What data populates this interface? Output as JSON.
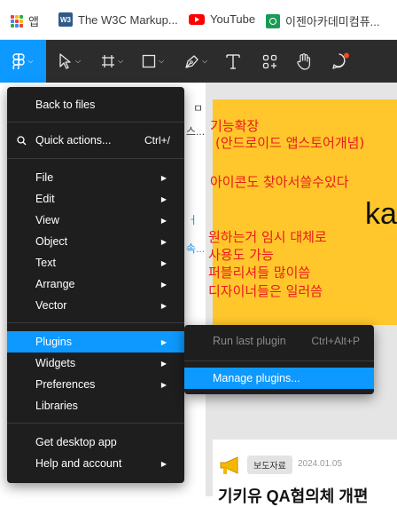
{
  "bookmarks": [
    {
      "label": "앱",
      "icon": "apps-grid-icon"
    },
    {
      "label": "The W3C Markup...",
      "icon": "w3c-icon"
    },
    {
      "label": "YouTube",
      "icon": "youtube-icon"
    },
    {
      "label": "이젠아카데미컴퓨...",
      "icon": "academy-icon"
    }
  ],
  "toolbar": {
    "tools": [
      "main-menu",
      "move",
      "frame",
      "shape",
      "pen",
      "text",
      "resources",
      "hand",
      "comment"
    ],
    "accent": "#0d99ff",
    "dark": "#2c2c2c"
  },
  "menu": {
    "back": "Back to files",
    "quick_actions": "Quick actions...",
    "quick_actions_shortcut": "Ctrl+/",
    "file": "File",
    "edit": "Edit",
    "view": "View",
    "object": "Object",
    "text": "Text",
    "arrange": "Arrange",
    "vector": "Vector",
    "plugins": "Plugins",
    "widgets": "Widgets",
    "preferences": "Preferences",
    "libraries": "Libraries",
    "desktop_app": "Get desktop app",
    "help": "Help and account"
  },
  "submenu": {
    "run_last": "Run last plugin",
    "run_last_shortcut": "Ctrl+Alt+P",
    "manage": "Manage plugins..."
  },
  "left_panel": {
    "page_frag": "ㅁ",
    "frag1": "스...",
    "frag2": "ㅓ",
    "frag3": "속..."
  },
  "canvas": {
    "notes": [
      "기능확장",
      "(안드로이드 앱스토어개념)",
      "아이콘도 찾아서쓸수있다",
      "원하는거 임시 대체로",
      "사용도 가능",
      "퍼블리셔들 많이씀",
      "디자이너들은 일러씀"
    ],
    "brand_text": "ka",
    "news_badge": "보도자료",
    "news_date": "2024.01.05",
    "news_title": "기키유 QA협의체 개편"
  }
}
